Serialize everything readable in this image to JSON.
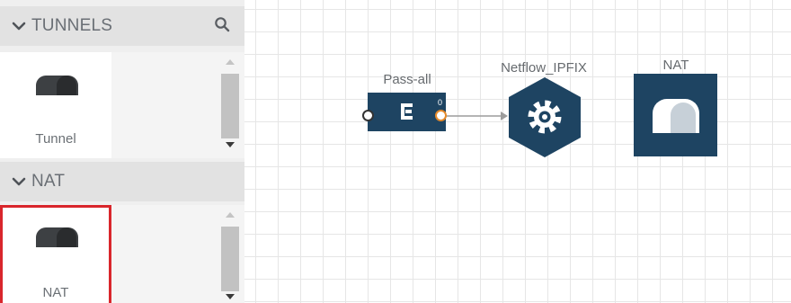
{
  "sidebar": {
    "tunnels": {
      "title": "TUNNELS",
      "item_label": "Tunnel"
    },
    "nat": {
      "title": "NAT",
      "item_label": "NAT"
    }
  },
  "canvas": {
    "nodes": [
      {
        "label": "Pass-all",
        "port_badge": "0",
        "icon": "filter-e-icon"
      },
      {
        "label": "Netflow_IPFIX",
        "icon": "gear-icon"
      },
      {
        "label": "NAT",
        "icon": "tunnel-icon"
      }
    ]
  },
  "colors": {
    "node_fill": "#1e4462",
    "selection_border": "#d9262c",
    "port_out": "#e58a2a",
    "connector": "#9c9c9c"
  }
}
